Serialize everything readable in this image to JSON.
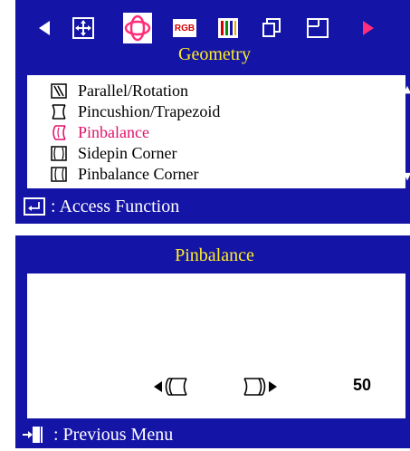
{
  "top_panel": {
    "title": "Geometry",
    "icons": [
      "left-arrow-icon",
      "position-icon",
      "geometry-icon",
      "rgb-icon",
      "color-bars-icon",
      "display-mode-icon",
      "osd-window-icon",
      "right-arrow-icon"
    ],
    "rgb_label": "RGB",
    "menu_items": [
      {
        "label": "Parallel/Rotation",
        "icon": "parallel-rotation-icon"
      },
      {
        "label": "Pincushion/Trapezoid",
        "icon": "pincushion-trapezoid-icon"
      },
      {
        "label": "Pinbalance",
        "icon": "pinbalance-icon",
        "selected": true
      },
      {
        "label": "Sidepin Corner",
        "icon": "sidepin-corner-icon"
      },
      {
        "label": "Pinbalance Corner",
        "icon": "pinbalance-corner-icon"
      }
    ],
    "status_text": ": Access Function",
    "colors": {
      "panel": "#1414a6",
      "title": "#ffee22",
      "selected": "#e0116a"
    }
  },
  "bottom_panel": {
    "title": "Pinbalance",
    "value": "50",
    "status_text": ": Previous Menu"
  }
}
